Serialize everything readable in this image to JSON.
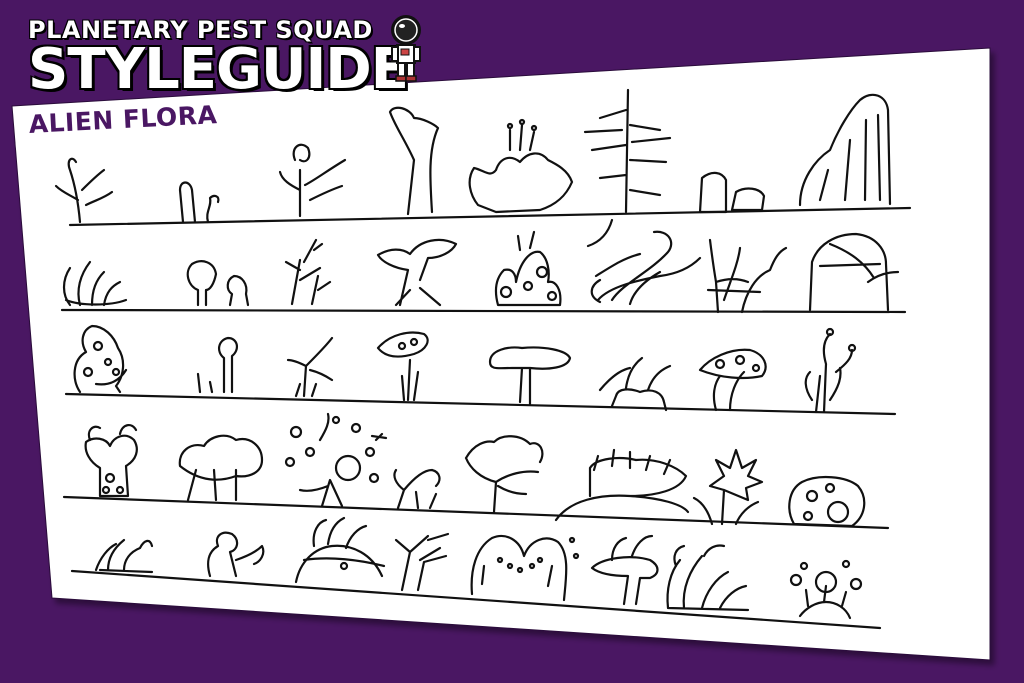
{
  "header": {
    "subtitle": "PLANETARY PEST SQUAD",
    "title": "STYLEGUIDE"
  },
  "section": {
    "label": "ALIEN FLORA"
  },
  "colors": {
    "background": "#4a1763",
    "paper": "#ffffff",
    "ink": "#111111",
    "label": "#4a1763"
  },
  "sheet": {
    "content": "sketches of alien plants arranged in five rows"
  }
}
